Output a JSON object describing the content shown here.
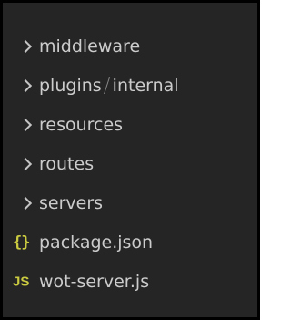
{
  "explorer": {
    "folders": [
      {
        "label": "middleware"
      },
      {
        "label_first": "plugins",
        "label_second": "internal"
      },
      {
        "label": "resources"
      },
      {
        "label": "routes"
      },
      {
        "label": "servers"
      }
    ],
    "files": [
      {
        "label": "package.json",
        "icon": "json-braces-icon",
        "icon_glyph": "{}"
      },
      {
        "label": "wot-server.js",
        "icon": "javascript-file-icon",
        "icon_glyph": "JS"
      }
    ]
  },
  "colors": {
    "background": "#252526",
    "text": "#cccccc",
    "chevron": "#c5c5c5",
    "file_icon": "#cbcb41",
    "border": "#000000"
  }
}
